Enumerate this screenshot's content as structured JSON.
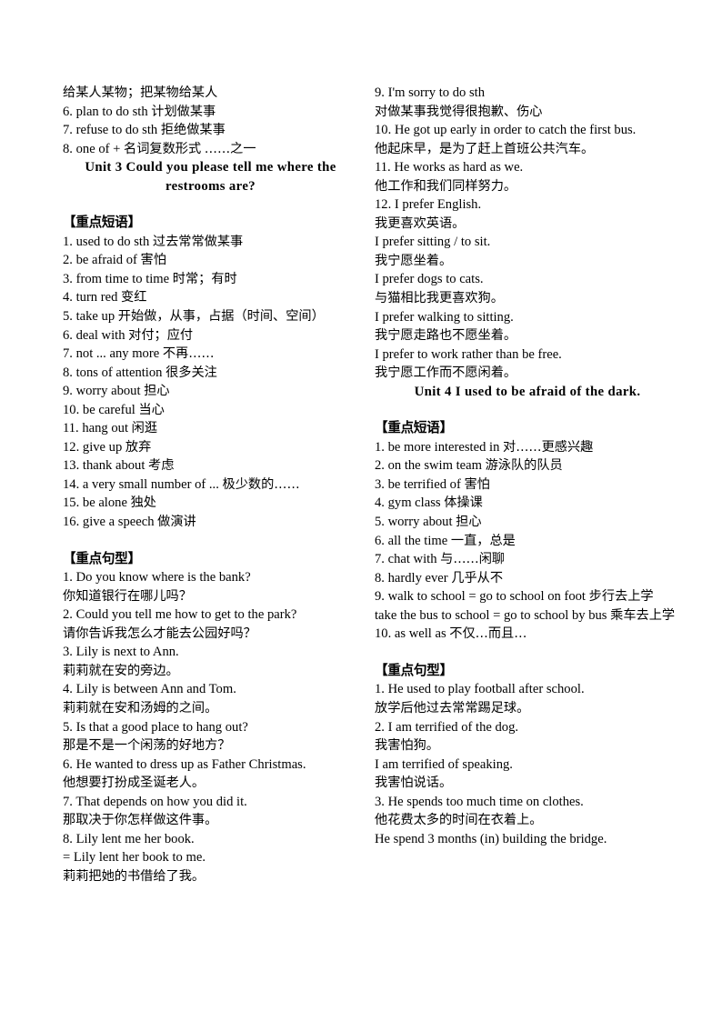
{
  "document": {
    "language_mix": "english-chinese",
    "left_column": {
      "blocks": [
        {
          "kind": "cn",
          "text": "给某人某物；把某物给某人"
        },
        {
          "kind": "mix",
          "text": "6. plan to do sth 计划做某事"
        },
        {
          "kind": "mix",
          "text": "7. refuse to do sth 拒绝做某事"
        },
        {
          "kind": "mix",
          "text": "8. one of +  名词复数形式  ……之一"
        },
        {
          "kind": "unit-title-1",
          "text": "Unit 3 Could you please tell me where the"
        },
        {
          "kind": "unit-title-2",
          "text": "restrooms are?"
        },
        {
          "kind": "spacer",
          "text": ""
        },
        {
          "kind": "header",
          "text": "【重点短语】"
        },
        {
          "kind": "mix",
          "text": "1. used to do sth 过去常常做某事"
        },
        {
          "kind": "mix",
          "text": "2. be afraid of  害怕"
        },
        {
          "kind": "mix",
          "text": "3. from time to time  时常；有时"
        },
        {
          "kind": "mix",
          "text": "4. turn red  变红"
        },
        {
          "kind": "mix",
          "text": "5. take up  开始做，从事，占据（时间、空间）"
        },
        {
          "kind": "mix",
          "text": "6. deal with  对付；应付"
        },
        {
          "kind": "mix",
          "text": "7. not ... any more  不再……"
        },
        {
          "kind": "mix",
          "text": "8. tons of attention 很多关注"
        },
        {
          "kind": "mix",
          "text": "9. worry about  担心"
        },
        {
          "kind": "mix",
          "text": "10. be careful  当心"
        },
        {
          "kind": "mix",
          "text": "11. hang out  闲逛"
        },
        {
          "kind": "mix",
          "text": "12. give up  放弃"
        },
        {
          "kind": "mix",
          "text": "13. thank about  考虑"
        },
        {
          "kind": "mix",
          "text": "14. a very small number of ...  极少数的……"
        },
        {
          "kind": "mix",
          "text": "15. be alone  独处"
        },
        {
          "kind": "mix",
          "text": "16. give a speech  做演讲"
        },
        {
          "kind": "spacer",
          "text": ""
        },
        {
          "kind": "header",
          "text": "【重点句型】"
        },
        {
          "kind": "en",
          "text": "1. Do you know where is the bank?"
        },
        {
          "kind": "cn",
          "text": "你知道银行在哪儿吗？"
        },
        {
          "kind": "en",
          "text": "2. Could you tell me how to get to the park?"
        },
        {
          "kind": "cn",
          "text": "请你告诉我怎么才能去公园好吗？"
        },
        {
          "kind": "en",
          "text": "3. Lily is next to Ann."
        },
        {
          "kind": "cn",
          "text": "莉莉就在安的旁边。"
        },
        {
          "kind": "en",
          "text": "4. Lily is between Ann and Tom."
        },
        {
          "kind": "cn",
          "text": "莉莉就在安和汤姆的之间。"
        },
        {
          "kind": "en",
          "text": "5. Is that a good place to hang out?"
        },
        {
          "kind": "cn",
          "text": "那是不是一个闲荡的好地方？"
        },
        {
          "kind": "en",
          "text": "6. He wanted to dress up as Father Christmas."
        },
        {
          "kind": "cn",
          "text": "他想要打扮成圣诞老人。"
        },
        {
          "kind": "en",
          "text": "7. That depends on how you did it."
        },
        {
          "kind": "cn",
          "text": "那取决于你怎样做这件事。"
        },
        {
          "kind": "en",
          "text": "8. Lily lent me her book."
        },
        {
          "kind": "en",
          "text": "= Lily lent her book to me."
        },
        {
          "kind": "cn",
          "text": "莉莉把她的书借给了我。"
        }
      ]
    },
    "right_column": {
      "blocks": [
        {
          "kind": "en",
          "text": "9. I'm sorry to do sth"
        },
        {
          "kind": "cn",
          "text": "对做某事我觉得很抱歉、伤心"
        },
        {
          "kind": "en",
          "text": "10. He got up early in order to catch the first bus."
        },
        {
          "kind": "cn",
          "text": "他起床早，是为了赶上首班公共汽车。"
        },
        {
          "kind": "en",
          "text": "11. He works as hard as we."
        },
        {
          "kind": "cn",
          "text": "他工作和我们同样努力。"
        },
        {
          "kind": "en",
          "text": "12. I prefer English."
        },
        {
          "kind": "cn",
          "text": "我更喜欢英语。"
        },
        {
          "kind": "en",
          "text": "I prefer sitting / to sit."
        },
        {
          "kind": "cn",
          "text": "我宁愿坐着。"
        },
        {
          "kind": "en",
          "text": "I prefer dogs to cats."
        },
        {
          "kind": "cn",
          "text": "与猫相比我更喜欢狗。"
        },
        {
          "kind": "en",
          "text": "I prefer walking to sitting."
        },
        {
          "kind": "cn",
          "text": "我宁愿走路也不愿坐着。"
        },
        {
          "kind": "en",
          "text": "I prefer to work rather than be free."
        },
        {
          "kind": "cn",
          "text": "我宁愿工作而不愿闲着。"
        },
        {
          "kind": "unit-title-single",
          "text": "Unit 4 I used to be afraid of the dark."
        },
        {
          "kind": "spacer",
          "text": ""
        },
        {
          "kind": "header",
          "text": "【重点短语】"
        },
        {
          "kind": "mix",
          "text": "1. be more interested in  对……更感兴趣"
        },
        {
          "kind": "mix",
          "text": "2. on the swim team 游泳队的队员"
        },
        {
          "kind": "mix",
          "text": "3. be terrified of  害怕"
        },
        {
          "kind": "mix",
          "text": "4. gym class  体操课"
        },
        {
          "kind": "mix",
          "text": "5. worry about  担心"
        },
        {
          "kind": "mix",
          "text": "6. all the time  一直，总是"
        },
        {
          "kind": "mix",
          "text": "7. chat with 与……闲聊"
        },
        {
          "kind": "mix",
          "text": "8. hardly ever  几乎从不"
        },
        {
          "kind": "mix",
          "text": "9. walk to school = go to school on foot  步行去上学"
        },
        {
          "kind": "mix",
          "text": "take the bus to school = go to school by bus  乘车去上学"
        },
        {
          "kind": "mix",
          "text": "10. as well as  不仅…而且…"
        },
        {
          "kind": "spacer",
          "text": ""
        },
        {
          "kind": "header",
          "text": "【重点句型】"
        },
        {
          "kind": "en",
          "text": "1. He used to play football after school."
        },
        {
          "kind": "cn",
          "text": "放学后他过去常常踢足球。"
        },
        {
          "kind": "en",
          "text": "2. I am terrified of the dog."
        },
        {
          "kind": "cn",
          "text": "我害怕狗。"
        },
        {
          "kind": "en",
          "text": "I am terrified of speaking."
        },
        {
          "kind": "cn",
          "text": "我害怕说话。"
        },
        {
          "kind": "en",
          "text": "3. He spends too much time on clothes."
        },
        {
          "kind": "cn",
          "text": "他花费太多的时间在衣着上。"
        },
        {
          "kind": "en",
          "text": "He spend 3 months (in) building the bridge."
        }
      ]
    }
  }
}
